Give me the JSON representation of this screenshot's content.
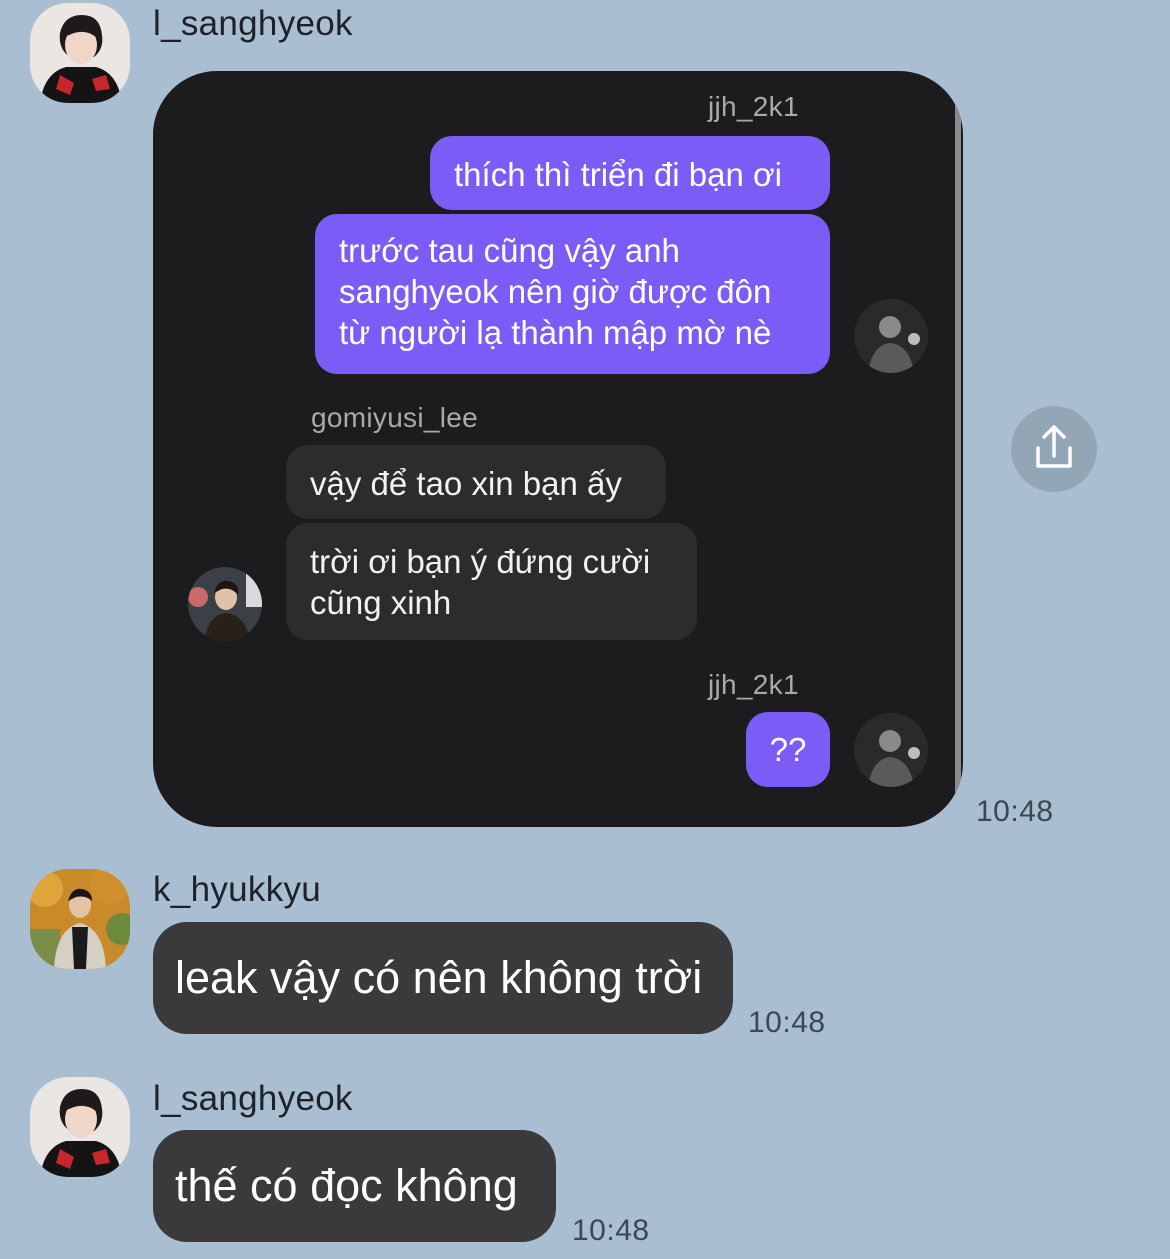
{
  "messages": [
    {
      "sender": "l_sanghyeok",
      "time": "10:48",
      "screenshot": {
        "name_1": "jjh_2k1",
        "msg_1": "thích thì triển đi bạn ơi",
        "msg_2": [
          "trước tau cũng vậy anh",
          "sanghyeok nên giờ được đôn",
          "từ người lạ thành mập mờ nè"
        ],
        "name_2": "gomiyusi_lee",
        "msg_3": "vậy để tao xin bạn ấy",
        "msg_4": [
          "trời ơi bạn ý đứng cười",
          "cũng xinh"
        ],
        "name_3": "jjh_2k1",
        "msg_5": "??"
      }
    },
    {
      "sender": "k_hyukkyu",
      "text": "leak vậy có nên không trời",
      "time": "10:48"
    },
    {
      "sender": "l_sanghyeok",
      "text": "thế có đọc không",
      "time": "10:48"
    }
  ],
  "icons": {
    "share": "share-icon"
  },
  "colors": {
    "background": "#a9bfd1",
    "bubble": "#3a3a3c",
    "screenshot_bg": "#1c1c1e",
    "ig_purple": "#7c5cf6",
    "ig_grey": "#2c2c2e"
  }
}
